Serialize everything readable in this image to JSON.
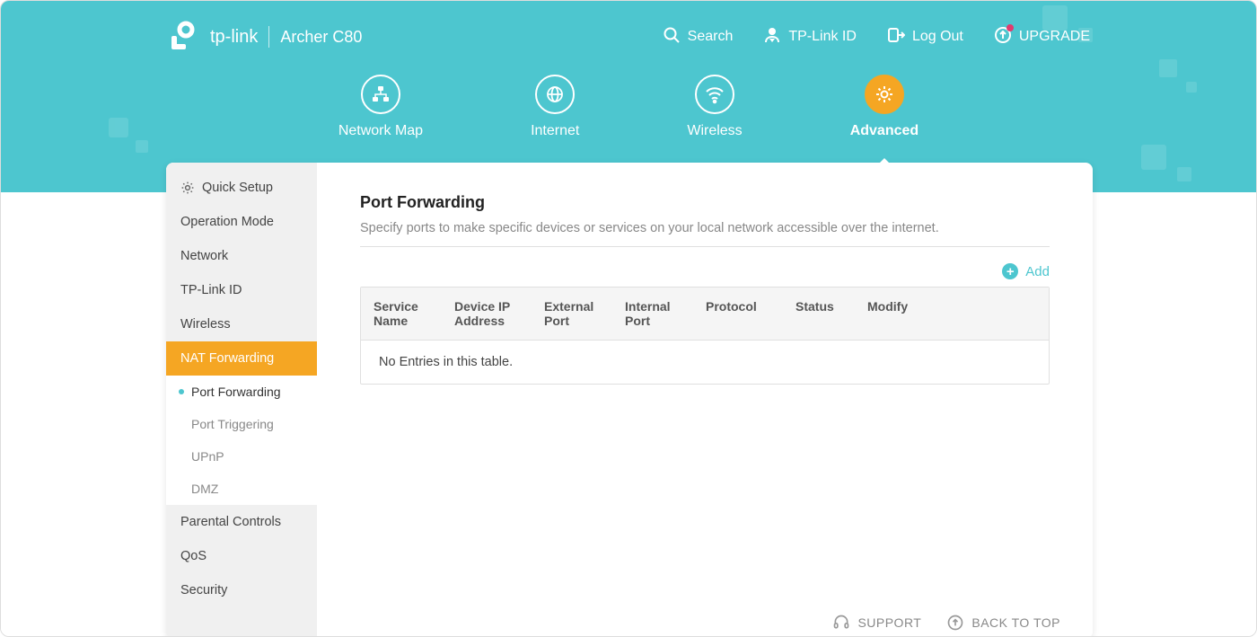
{
  "brand": {
    "name": "tp-link",
    "model": "Archer C80"
  },
  "top_actions": {
    "search": "Search",
    "tplink_id": "TP-Link ID",
    "logout": "Log Out",
    "upgrade": "UPGRADE"
  },
  "nav_tabs": [
    {
      "label": "Network Map"
    },
    {
      "label": "Internet"
    },
    {
      "label": "Wireless"
    },
    {
      "label": "Advanced"
    }
  ],
  "sidebar": {
    "items": [
      {
        "label": "Quick Setup"
      },
      {
        "label": "Operation Mode"
      },
      {
        "label": "Network"
      },
      {
        "label": "TP-Link ID"
      },
      {
        "label": "Wireless"
      },
      {
        "label": "NAT Forwarding"
      },
      {
        "label": "Parental Controls"
      },
      {
        "label": "QoS"
      },
      {
        "label": "Security"
      }
    ],
    "sub_items": [
      {
        "label": "Port Forwarding"
      },
      {
        "label": "Port Triggering"
      },
      {
        "label": "UPnP"
      },
      {
        "label": "DMZ"
      }
    ]
  },
  "content": {
    "title": "Port Forwarding",
    "description": "Specify ports to make specific devices or services on your local network accessible over the internet.",
    "add_label": "Add",
    "columns": [
      "Service Name",
      "Device IP Address",
      "External Port",
      "Internal Port",
      "Protocol",
      "Status",
      "Modify"
    ],
    "empty_text": "No Entries in this table."
  },
  "footer": {
    "support": "SUPPORT",
    "back_to_top": "BACK TO TOP"
  }
}
